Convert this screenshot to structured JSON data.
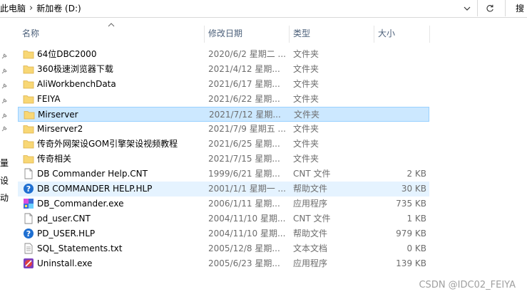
{
  "address_bar": {
    "crumbs": [
      "此电脑",
      "新加卷 (D:)"
    ],
    "search_label": "搜"
  },
  "nav_fragments": [
    "量",
    "设",
    "动"
  ],
  "columns": {
    "name": "名称",
    "date": "修改日期",
    "type": "类型",
    "size": "大小"
  },
  "files": [
    {
      "name": "64位DBC2000",
      "date": "2020/6/2 星期二 ...",
      "type": "文件夹",
      "size": "",
      "icon": "folder-icon"
    },
    {
      "name": "360极速浏览器下载",
      "date": "2021/4/12 星期...",
      "type": "文件夹",
      "size": "",
      "icon": "folder-icon"
    },
    {
      "name": "AliWorkbenchData",
      "date": "2021/6/17 星期...",
      "type": "文件夹",
      "size": "",
      "icon": "folder-icon"
    },
    {
      "name": "FEIYA",
      "date": "2021/6/22 星期...",
      "type": "文件夹",
      "size": "",
      "icon": "folder-icon"
    },
    {
      "name": "Mirserver",
      "date": "2021/7/12 星期...",
      "type": "文件夹",
      "size": "",
      "icon": "folder-icon"
    },
    {
      "name": "Mirserver2",
      "date": "2021/7/9 星期五 ...",
      "type": "文件夹",
      "size": "",
      "icon": "folder-icon"
    },
    {
      "name": "传奇外网架设GOM引擎架设视频教程",
      "date": "2021/6/25 星期...",
      "type": "文件夹",
      "size": "",
      "icon": "folder-icon"
    },
    {
      "name": "传奇相关",
      "date": "2021/7/15 星期...",
      "type": "文件夹",
      "size": "",
      "icon": "folder-icon"
    },
    {
      "name": "DB Commander Help.CNT",
      "date": "1999/6/21 星期...",
      "type": "CNT 文件",
      "size": "2 KB",
      "icon": "document-icon"
    },
    {
      "name": "DB COMMANDER HELP.HLP",
      "date": "2001/1/1 星期一 ...",
      "type": "帮助文件",
      "size": "30 KB",
      "icon": "help-icon"
    },
    {
      "name": "DB_Commander.exe",
      "date": "2006/1/11 星期...",
      "type": "应用程序",
      "size": "735 KB",
      "icon": "app-icon"
    },
    {
      "name": "pd_user.CNT",
      "date": "2004/11/10 星期...",
      "type": "CNT 文件",
      "size": "1 KB",
      "icon": "document-icon"
    },
    {
      "name": "PD_USER.HLP",
      "date": "2004/11/10 星期...",
      "type": "帮助文件",
      "size": "979 KB",
      "icon": "help-icon"
    },
    {
      "name": "SQL_Statements.txt",
      "date": "2005/12/8 星期...",
      "type": "文本文档",
      "size": "0 KB",
      "icon": "text-file-icon"
    },
    {
      "name": "Uninstall.exe",
      "date": "2005/6/23 星期...",
      "type": "应用程序",
      "size": "139 KB",
      "icon": "uninstall-icon"
    }
  ],
  "selected_row": "Mirserver",
  "hover_row": "DB COMMANDER HELP.HLP",
  "watermark": "CSDN @IDC02_FEIYA",
  "colors": {
    "selection_bg": "#cce8ff",
    "selection_border": "#99d1ff",
    "hover_bg": "#e5f3ff",
    "header_text": "#4c607a",
    "folder": "#f8d775"
  }
}
